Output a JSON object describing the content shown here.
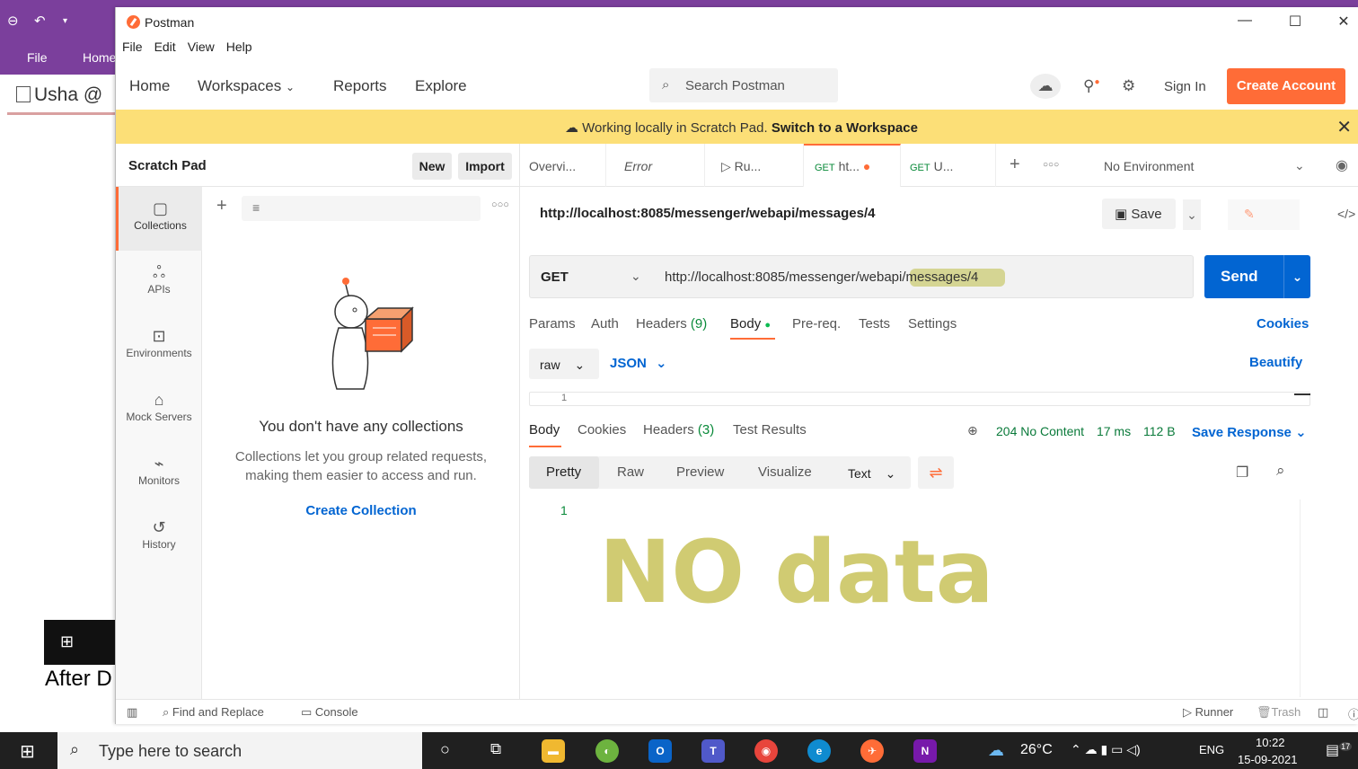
{
  "onenote": {
    "menu": [
      "File",
      "Home"
    ],
    "page_label": "Usha @",
    "note_text": "After D"
  },
  "window": {
    "title": "Postman",
    "menu": [
      "File",
      "Edit",
      "View",
      "Help"
    ]
  },
  "header": {
    "nav": [
      "Home",
      "Workspaces",
      "Reports",
      "Explore"
    ],
    "search_placeholder": "Search Postman",
    "sign_in": "Sign In",
    "create_account": "Create Account"
  },
  "banner": {
    "text": "Working locally in Scratch Pad.",
    "link": "Switch to a Workspace"
  },
  "sidebar": {
    "title": "Scratch Pad",
    "new_label": "New",
    "import_label": "Import",
    "rail": [
      {
        "label": "Collections",
        "icon": "collections-icon"
      },
      {
        "label": "APIs",
        "icon": "apis-icon"
      },
      {
        "label": "Environments",
        "icon": "environments-icon"
      },
      {
        "label": "Mock Servers",
        "icon": "mock-servers-icon"
      },
      {
        "label": "Monitors",
        "icon": "monitors-icon"
      },
      {
        "label": "History",
        "icon": "history-icon"
      }
    ],
    "empty_title": "You don't have any collections",
    "empty_desc": "Collections let you group related requests, making them easier to access and run.",
    "create_collection": "Create Collection"
  },
  "tabs": [
    {
      "label": "Overvi...",
      "method": ""
    },
    {
      "label": "Error",
      "method": ""
    },
    {
      "label": "Ru...",
      "method": ""
    },
    {
      "label": "ht...",
      "method": "GET"
    },
    {
      "label": "U...",
      "method": "GET"
    }
  ],
  "environment": "No Environment",
  "request": {
    "name": "http://localhost:8085/messenger/webapi/messages/4",
    "save_label": "Save",
    "method": "GET",
    "url": "http://localhost:8085/messenger/webapi/messages/4",
    "send_label": "Send",
    "tabs": [
      "Params",
      "Auth",
      "Headers",
      "(9)",
      "Body",
      "Pre-req.",
      "Tests",
      "Settings"
    ],
    "cookies": "Cookies",
    "body_mode": "raw",
    "body_lang": "JSON",
    "beautify": "Beautify",
    "editor_line": "1"
  },
  "response": {
    "tabs": [
      "Body",
      "Cookies",
      "Headers",
      "(3)",
      "Test Results"
    ],
    "status": "204 No Content",
    "time": "17 ms",
    "size": "112 B",
    "save_response": "Save Response",
    "views": [
      "Pretty",
      "Raw",
      "Preview",
      "Visualize"
    ],
    "format": "Text",
    "line": "1",
    "handwritten_note": "NO data"
  },
  "statusbar": {
    "find_replace": "Find and Replace",
    "console": "Console",
    "runner": "Runner",
    "trash": "Trash"
  },
  "taskbar": {
    "search_placeholder": "Type here to search",
    "temperature": "26°C",
    "lang": "ENG",
    "time": "10:22",
    "date": "15-09-2021",
    "notifications": "17"
  },
  "colors": {
    "accent": "#ff6c37",
    "link": "#0265d2",
    "banner": "#fcdf77",
    "onenote": "#7b3f9c"
  }
}
